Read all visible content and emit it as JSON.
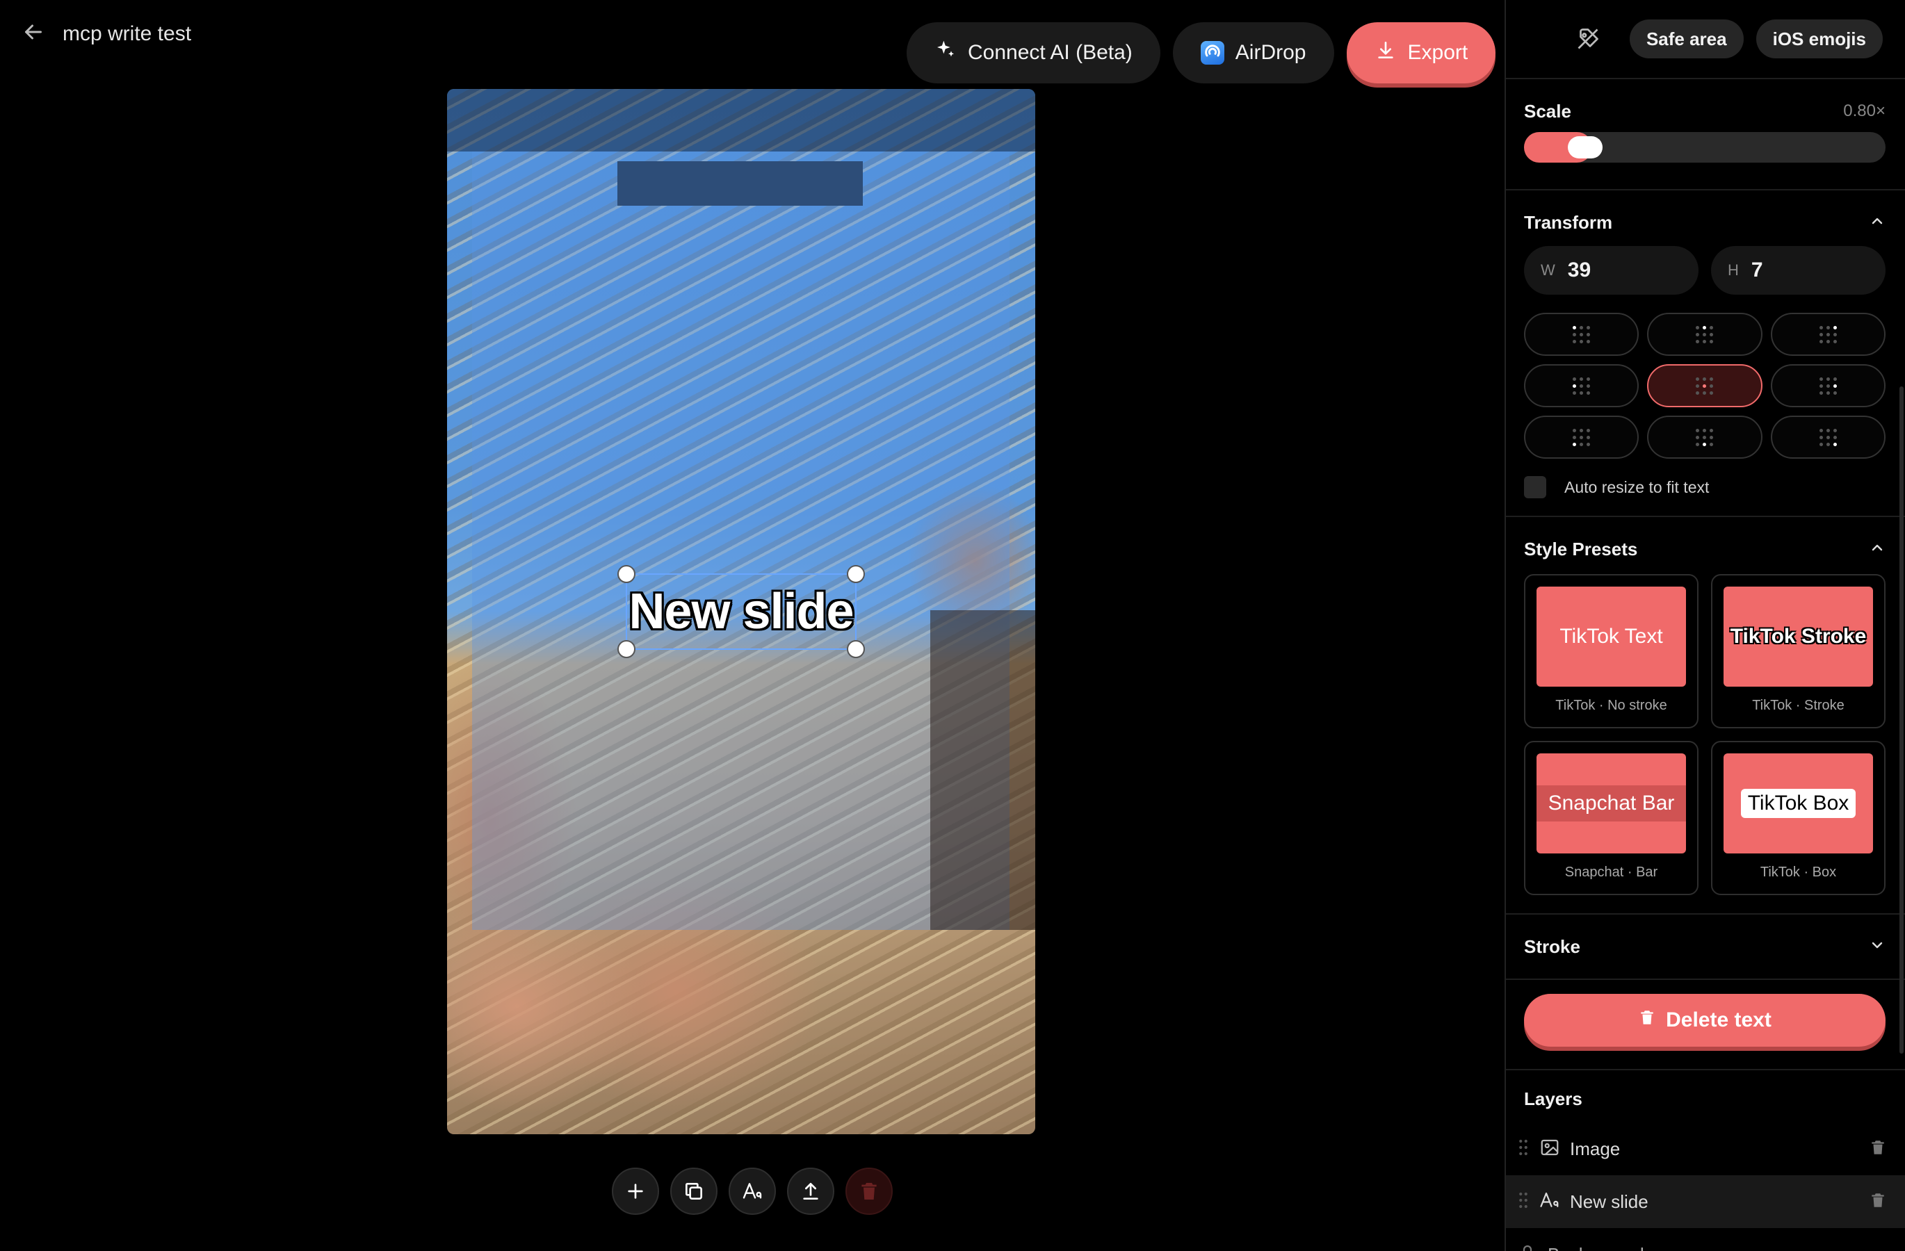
{
  "header": {
    "project_title": "mcp write test",
    "connect_ai_label": "Connect AI (Beta)",
    "airdrop_label": "AirDrop",
    "export_label": "Export"
  },
  "canvas": {
    "text_layer_text": "New slide"
  },
  "panel": {
    "top": {
      "safe_area_label": "Safe area",
      "ios_emojis_label": "iOS emojis"
    },
    "scale": {
      "title": "Scale",
      "value_text": "0.80×",
      "fraction": 0.14
    },
    "transform": {
      "title": "Transform",
      "w_label": "W",
      "w_value": "39",
      "h_label": "H",
      "h_value": "7",
      "active_anchor": "middle-center",
      "auto_resize_label": "Auto resize to fit text"
    },
    "style_presets": {
      "title": "Style Presets",
      "items": [
        {
          "thumb": "TikTok Text",
          "caption": "TikTok · No stroke"
        },
        {
          "thumb": "TikTok Stroke",
          "caption": "TikTok · Stroke"
        },
        {
          "thumb": "Snapchat Bar",
          "caption": "Snapchat · Bar"
        },
        {
          "thumb": "TikTok Box",
          "caption": "TikTok · Box"
        }
      ]
    },
    "stroke": {
      "title": "Stroke"
    },
    "delete_label": "Delete text",
    "layers": {
      "title": "Layers",
      "items": [
        {
          "name": "Image"
        },
        {
          "name": "New slide"
        },
        {
          "name": "Background"
        }
      ]
    }
  },
  "colors": {
    "accent": "#f06a6a",
    "panel_bg": "#000000",
    "selection": "#6aa6ff"
  }
}
